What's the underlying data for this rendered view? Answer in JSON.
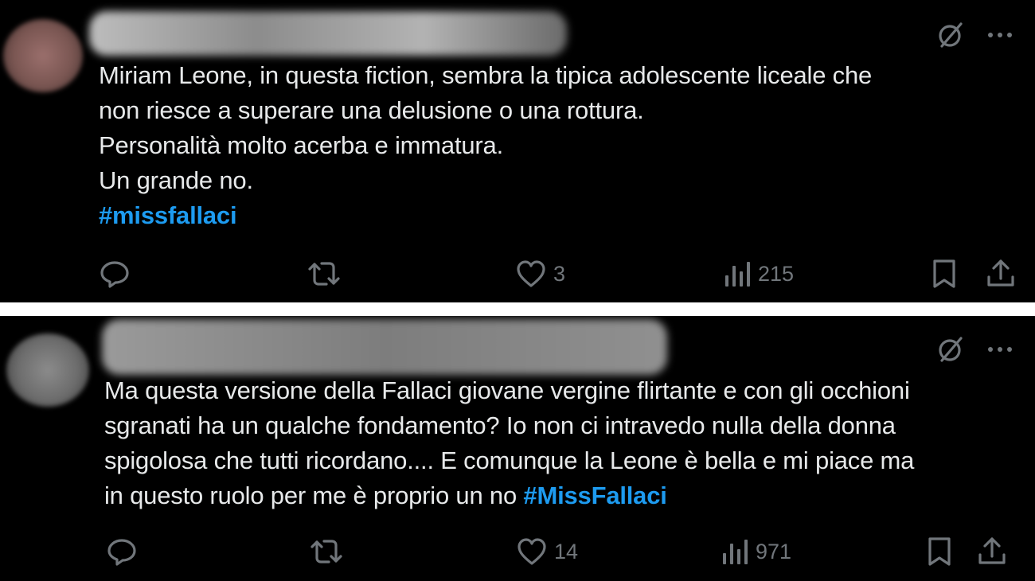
{
  "tweets": [
    {
      "lines": [
        "Miriam Leone, in questa fiction, sembra la tipica adolescente liceale che",
        "non riesce a superare una delusione o una rottura.",
        "Personalità molto acerba e immatura.",
        "Un grande no."
      ],
      "hashtag": "#missfallaci",
      "likes": "3",
      "views": "215"
    },
    {
      "lines": [
        "Ma questa versione della Fallaci giovane vergine flirtante e con gli occhioni",
        "sgranati ha un qualche fondamento? Io non ci intravedo nulla della donna",
        "spigolosa che tutti ricordano.... E comunque la Leone è bella e mi piace ma",
        "in questo ruolo per me è proprio un no "
      ],
      "hashtag": "#MissFallaci",
      "likes": "14",
      "views": "971"
    }
  ],
  "icons": {
    "top": [
      "grok-icon",
      "more-icon"
    ],
    "actions": [
      "reply-icon",
      "retweet-icon",
      "like-icon",
      "views-icon",
      "bookmark-icon",
      "share-icon"
    ]
  },
  "colors": {
    "background": "#000000",
    "text": "#e7e9ea",
    "muted": "#71767b",
    "hashtag": "#1d9bf0"
  }
}
